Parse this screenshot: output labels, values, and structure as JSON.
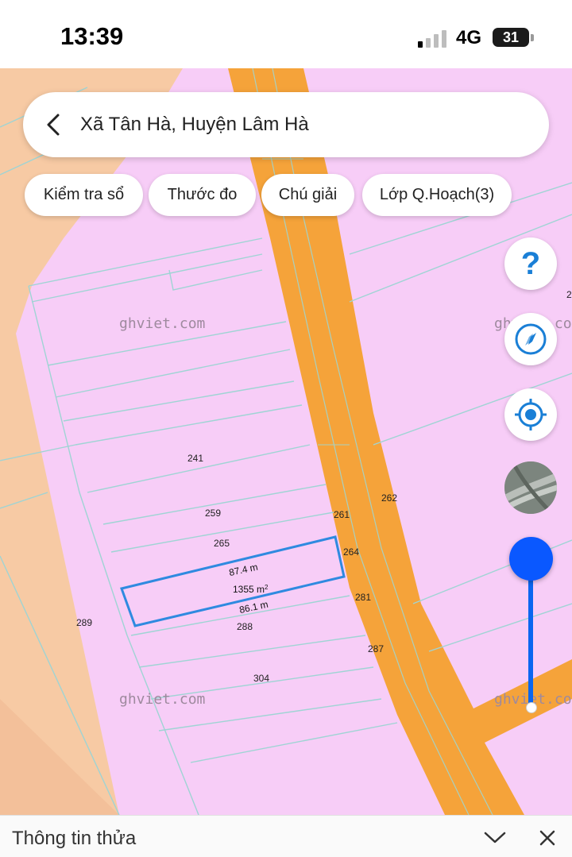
{
  "status_bar": {
    "time": "13:39",
    "network": "4G",
    "battery": "31"
  },
  "search": {
    "location": "Xã Tân Hà, Huyện Lâm Hà"
  },
  "chips": [
    "Kiểm tra sổ",
    "Thước đo",
    "Chú giải",
    "Lớp Q.Hoạch(3)"
  ],
  "map": {
    "watermark": "ghviet.com",
    "parcel_labels": [
      "241",
      "259",
      "261",
      "262",
      "265",
      "264",
      "281",
      "287",
      "288",
      "289",
      "304"
    ],
    "selected_parcel": {
      "top_edge": "87.4 m",
      "bottom_edge": "86.1 m",
      "area_value": "1355 m",
      "area_unit_sup": "2"
    },
    "edge_label": "2",
    "colors": {
      "residential": "#f7cdf7",
      "agricultural": "#f7caa4",
      "road": "#f5a33a",
      "selection": "#2f8ae0"
    }
  },
  "controls": {
    "help": "?",
    "icons": [
      "help-icon",
      "compass-icon",
      "locate-icon",
      "satellite-layer-thumbnail",
      "opacity-slider"
    ]
  },
  "bottom_sheet": {
    "title": "Thông tin thửa"
  }
}
